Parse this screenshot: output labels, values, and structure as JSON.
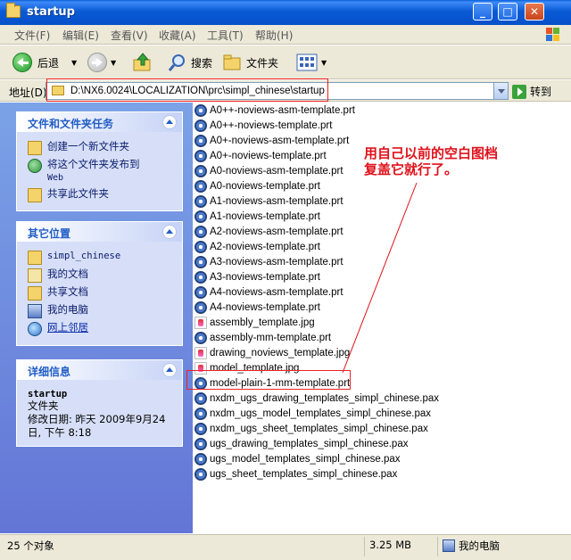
{
  "window": {
    "title": "startup"
  },
  "menu": [
    "文件(F)",
    "编辑(E)",
    "查看(V)",
    "收藏(A)",
    "工具(T)",
    "帮助(H)"
  ],
  "toolbar": {
    "back_label": "后退",
    "search_label": "搜索",
    "folders_label": "文件夹"
  },
  "address": {
    "label": "地址(D)",
    "path": "D:\\NX6.0024\\LOCALIZATION\\prc\\simpl_chinese\\startup",
    "go_label": "转到"
  },
  "panels": {
    "tasks": {
      "title": "文件和文件夹任务",
      "items": [
        "创建一个新文件夹",
        "将这个文件夹发布到",
        "Web",
        "共享此文件夹"
      ]
    },
    "places": {
      "title": "其它位置",
      "items": [
        "simpl_chinese",
        "我的文档",
        "共享文档",
        "我的电脑",
        "网上邻居"
      ]
    },
    "details": {
      "title": "详细信息",
      "name": "startup",
      "type": "文件夹",
      "modified_line1": "修改日期: 昨天 2009年9月24",
      "modified_line2": "日, 下午 8:18"
    }
  },
  "files": [
    {
      "name": "A0++-noviews-asm-template.prt",
      "kind": "prt"
    },
    {
      "name": "A0++-noviews-template.prt",
      "kind": "prt"
    },
    {
      "name": "A0+-noviews-asm-template.prt",
      "kind": "prt"
    },
    {
      "name": "A0+-noviews-template.prt",
      "kind": "prt"
    },
    {
      "name": "A0-noviews-asm-template.prt",
      "kind": "prt"
    },
    {
      "name": "A0-noviews-template.prt",
      "kind": "prt"
    },
    {
      "name": "A1-noviews-asm-template.prt",
      "kind": "prt"
    },
    {
      "name": "A1-noviews-template.prt",
      "kind": "prt"
    },
    {
      "name": "A2-noviews-asm-template.prt",
      "kind": "prt"
    },
    {
      "name": "A2-noviews-template.prt",
      "kind": "prt"
    },
    {
      "name": "A3-noviews-asm-template.prt",
      "kind": "prt"
    },
    {
      "name": "A3-noviews-template.prt",
      "kind": "prt"
    },
    {
      "name": "A4-noviews-asm-template.prt",
      "kind": "prt"
    },
    {
      "name": "A4-noviews-template.prt",
      "kind": "prt"
    },
    {
      "name": "assembly_template.jpg",
      "kind": "jpg"
    },
    {
      "name": "assembly-mm-template.prt",
      "kind": "prt"
    },
    {
      "name": "drawing_noviews_template.jpg",
      "kind": "jpg"
    },
    {
      "name": "model_template.jpg",
      "kind": "jpg"
    },
    {
      "name": "model-plain-1-mm-template.prt",
      "kind": "prt"
    },
    {
      "name": "nxdm_ugs_drawing_templates_simpl_chinese.pax",
      "kind": "pax"
    },
    {
      "name": "nxdm_ugs_model_templates_simpl_chinese.pax",
      "kind": "pax"
    },
    {
      "name": "nxdm_ugs_sheet_templates_simpl_chinese.pax",
      "kind": "pax"
    },
    {
      "name": "ugs_drawing_templates_simpl_chinese.pax",
      "kind": "pax"
    },
    {
      "name": "ugs_model_templates_simpl_chinese.pax",
      "kind": "pax"
    },
    {
      "name": "ugs_sheet_templates_simpl_chinese.pax",
      "kind": "pax"
    }
  ],
  "annotation": {
    "line1": "用自己以前的空白图档",
    "line2": "复盖它就行了。",
    "color": "#e0111b"
  },
  "status": {
    "count": "25 个对象",
    "size": "3.25 MB",
    "location": "我的电脑"
  }
}
